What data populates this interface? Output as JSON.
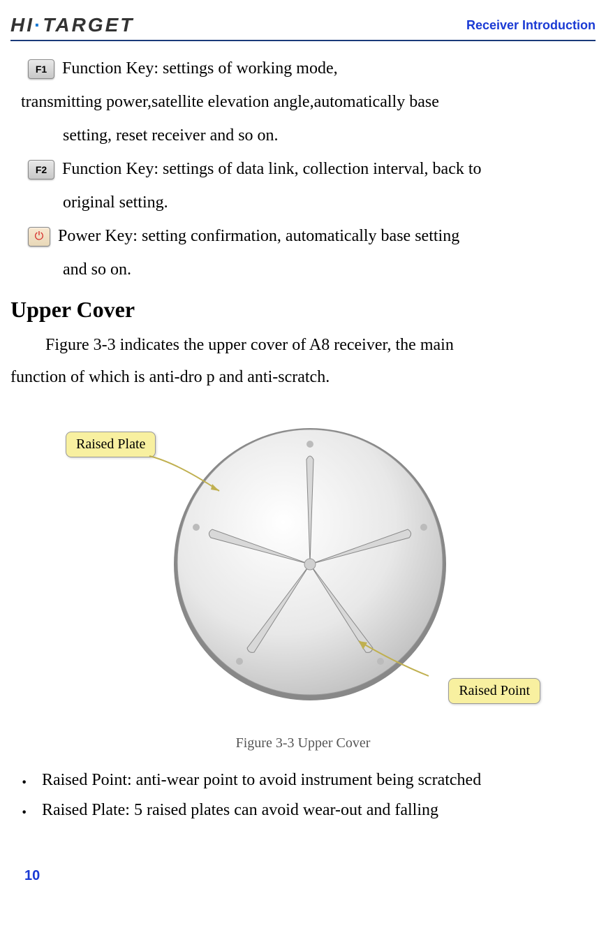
{
  "header": {
    "logo_text": "HI·TARGET",
    "title": "Receiver Introduction"
  },
  "keys": {
    "f1": {
      "label": "F1",
      "line1": " Function Key: settings of working mode,",
      "line2": "transmitting power,satellite elevation angle,automatically base",
      "line3": "setting, reset receiver and so on."
    },
    "f2": {
      "label": "F2",
      "line1": " Function Key: settings of data link, collection interval, back to",
      "line2": "original setting."
    },
    "power": {
      "line1": " Power Key: setting confirmation, automatically base setting",
      "line2": "and so on."
    }
  },
  "section": {
    "heading": "Upper Cover",
    "intro1": "Figure 3-3 indicates the upper cover of A8 receiver, the main",
    "intro2": "function of which is anti-dro p and anti-scratch."
  },
  "figure": {
    "callout1": "Raised Plate",
    "callout2": "Raised Point",
    "caption": "Figure 3-3 Upper Cover"
  },
  "bullets": {
    "item1": "Raised Point: anti-wear point to avoid instrument being scratched",
    "item2": "Raised Plate: 5 raised plates can avoid wear-out and falling"
  },
  "page_number": "10"
}
